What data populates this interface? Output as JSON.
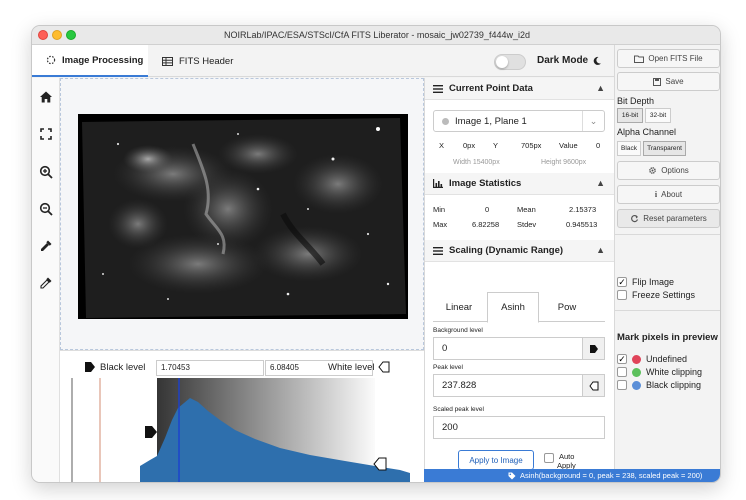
{
  "window": {
    "title": "NOIRLab/IPAC/ESA/STScI/CfA FITS Liberator - mosaic_jw02739_f444w_i2d"
  },
  "tabs": [
    {
      "label": "Image Processing",
      "active": true
    },
    {
      "label": "FITS Header",
      "active": false
    }
  ],
  "dark_mode": {
    "label": "Dark Mode",
    "on": false
  },
  "histogram": {
    "black_level_label": "Black level",
    "black_level_value": "1.70453",
    "white_level_label": "White level",
    "white_level_value": "6.08405",
    "fill_color": "#2e6fad"
  },
  "current_point": {
    "header": "Current Point Data",
    "plane": "Image 1, Plane 1",
    "x_label": "X",
    "x_value": "0px",
    "y_label": "Y",
    "y_value": "705px",
    "value_label": "Value",
    "value_value": "0",
    "width": "Width 15400px",
    "height": "Height 9600px"
  },
  "image_statistics": {
    "header": "Image Statistics",
    "min_label": "Min",
    "min_value": "0",
    "mean_label": "Mean",
    "mean_value": "2.15373",
    "max_label": "Max",
    "max_value": "6.82258",
    "stdev_label": "Stdev",
    "stdev_value": "0.945513"
  },
  "scaling": {
    "header": "Scaling (Dynamic Range)",
    "tabs": [
      {
        "label": "Linear",
        "active": false
      },
      {
        "label": "Asinh",
        "active": true
      },
      {
        "label": "Pow",
        "active": false
      }
    ],
    "background_label": "Background level",
    "background_value": "0",
    "peak_label": "Peak level",
    "peak_value": "237.828",
    "scaled_peak_label": "Scaled peak level",
    "scaled_peak_value": "200",
    "apply_label": "Apply to Image",
    "auto_apply_label_1": "Auto",
    "auto_apply_label_2": "Apply",
    "auto_apply_checked": false
  },
  "status": {
    "text": "Asinh(background = 0, peak = 238, scaled peak = 200)"
  },
  "right_panel": {
    "open_label": "Open FITS File",
    "save_label": "Save",
    "bit_depth_label": "Bit Depth",
    "bit_depth_options": [
      "16-bit",
      "32-bit"
    ],
    "bit_depth_selected": "16-bit",
    "alpha_label": "Alpha Channel",
    "alpha_options": [
      "Black",
      "Transparent"
    ],
    "alpha_selected": "Transparent",
    "options_label": "Options",
    "about_label": "About",
    "reset_label": "Reset parameters",
    "flip_label": "Flip Image",
    "flip_checked": true,
    "freeze_label": "Freeze Settings",
    "freeze_checked": false,
    "mark_header": "Mark pixels in preview",
    "undefined_label": "Undefined",
    "undefined_checked": true,
    "undefined_color": "#e0445a",
    "white_clip_label": "White clipping",
    "white_clip_checked": false,
    "white_clip_color": "#5cc05c",
    "black_clip_label": "Black clipping",
    "black_clip_checked": false,
    "black_clip_color": "#5b8fd8"
  }
}
